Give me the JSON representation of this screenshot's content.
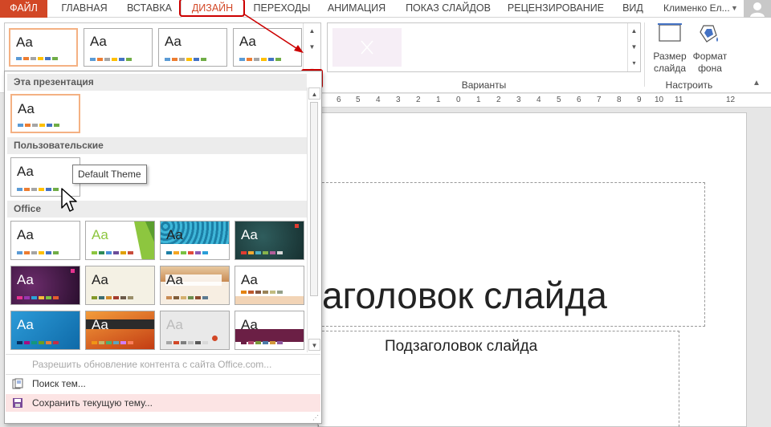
{
  "tabs": [
    {
      "id": "file",
      "label": "ФАЙЛ"
    },
    {
      "id": "home",
      "label": "ГЛАВНАЯ"
    },
    {
      "id": "insert",
      "label": "ВСТАВКА"
    },
    {
      "id": "design",
      "label": "ДИЗАЙН"
    },
    {
      "id": "transitions",
      "label": "ПЕРЕХОДЫ"
    },
    {
      "id": "animation",
      "label": "АНИМАЦИЯ"
    },
    {
      "id": "slideshow",
      "label": "ПОКАЗ СЛАЙДОВ"
    },
    {
      "id": "review",
      "label": "РЕЦЕНЗИРОВАНИЕ"
    },
    {
      "id": "view",
      "label": "ВИД"
    }
  ],
  "user": {
    "name": "Клименко Ел..."
  },
  "ribbon": {
    "variants_label": "Варианты",
    "customize_label": "Настроить",
    "slide_size": "Размер\nслайда",
    "bg_format": "Формат\nфона",
    "thumb_text": "Aa"
  },
  "ruler": {
    "numbers": [
      "6",
      "5",
      "4",
      "3",
      "2",
      "1",
      "0",
      "1",
      "2",
      "3",
      "4",
      "5",
      "6",
      "7",
      "8",
      "9",
      "10",
      "11",
      "12"
    ]
  },
  "slide": {
    "title": "аголовок слайда",
    "subtitle": "Подзаголовок слайда"
  },
  "dropdown": {
    "section_current": "Эта презентация",
    "section_custom": "Пользовательские",
    "section_office": "Office",
    "tooltip": "Default Theme",
    "menu": {
      "allow_updates": "Разрешить обновление контента с сайта Office.com...",
      "browse": "Поиск тем...",
      "save": "Сохранить текущую тему..."
    }
  },
  "colors": {
    "accent": "#d24726",
    "swatches": [
      "#5b9bd5",
      "#ed7d31",
      "#a5a5a5",
      "#ffc000",
      "#4472c4",
      "#70ad47"
    ]
  }
}
